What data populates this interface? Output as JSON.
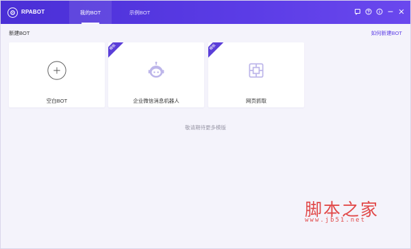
{
  "app": {
    "name": "RPABOT"
  },
  "tabs": [
    {
      "label": "我的BOT",
      "active": true
    },
    {
      "label": "示例BOT",
      "active": false
    }
  ],
  "window_controls": [
    "message-icon",
    "help-icon",
    "minimize-icon",
    "maximize-icon",
    "close-icon"
  ],
  "header": {
    "title": "新建BOT",
    "help_link": "如何新建BOT"
  },
  "cards": [
    {
      "label": "空白BOT",
      "icon": "plus-icon",
      "ribbon": ""
    },
    {
      "label": "企业微信消息机器人",
      "icon": "robot-icon",
      "ribbon": "模板"
    },
    {
      "label": "网页抓取",
      "icon": "web-grab-icon",
      "ribbon": "模板"
    }
  ],
  "more_templates": "敬请期待更多模版",
  "watermark": {
    "text": "脚本之家",
    "url": "www.jb51.net"
  },
  "colors": {
    "accent": "#5b3ce6",
    "background": "#f4f3fb",
    "watermark": "#e14848"
  }
}
